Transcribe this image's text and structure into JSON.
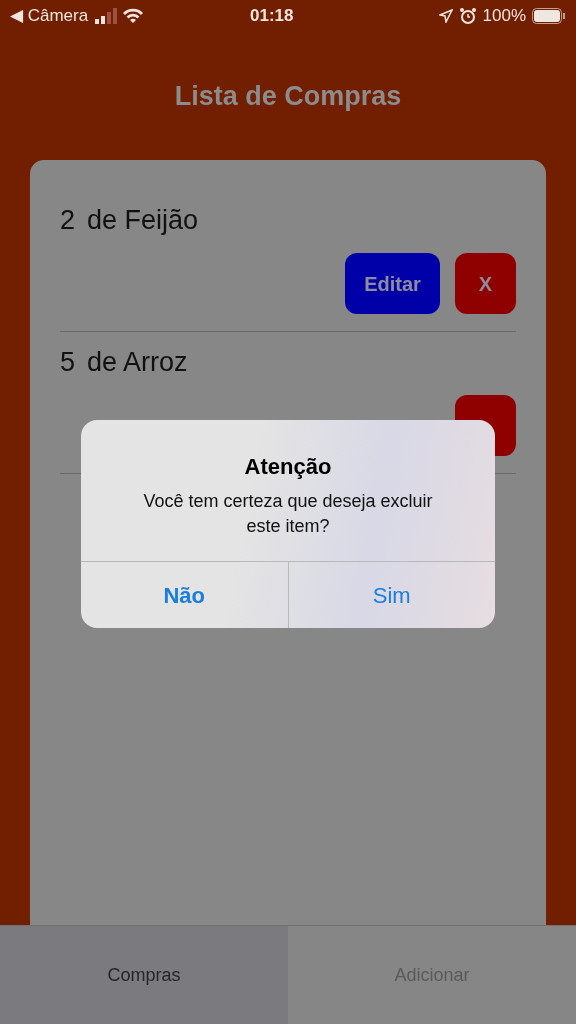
{
  "status_bar": {
    "back": "◀ Câmera",
    "time": "01:18",
    "battery": "100%"
  },
  "header": {
    "title": "Lista de Compras"
  },
  "items": [
    {
      "quantity": "2",
      "name": "de Feijão",
      "buttons": [
        {
          "kind": "edit",
          "label": "Editar"
        },
        {
          "kind": "delete",
          "label": "X"
        }
      ]
    },
    {
      "quantity": "5",
      "name": "de Arroz",
      "buttons": [
        {
          "kind": "delete"
        }
      ]
    }
  ],
  "alert": {
    "title": "Atenção",
    "message": "Você tem certeza que deseja excluir este item?",
    "actions": [
      {
        "label": "Não",
        "bold": true
      },
      {
        "label": "Sim",
        "bold": false
      }
    ]
  },
  "tabs": [
    {
      "label": "Compras",
      "selected": true
    },
    {
      "label": "Adicionar",
      "selected": false
    }
  ]
}
